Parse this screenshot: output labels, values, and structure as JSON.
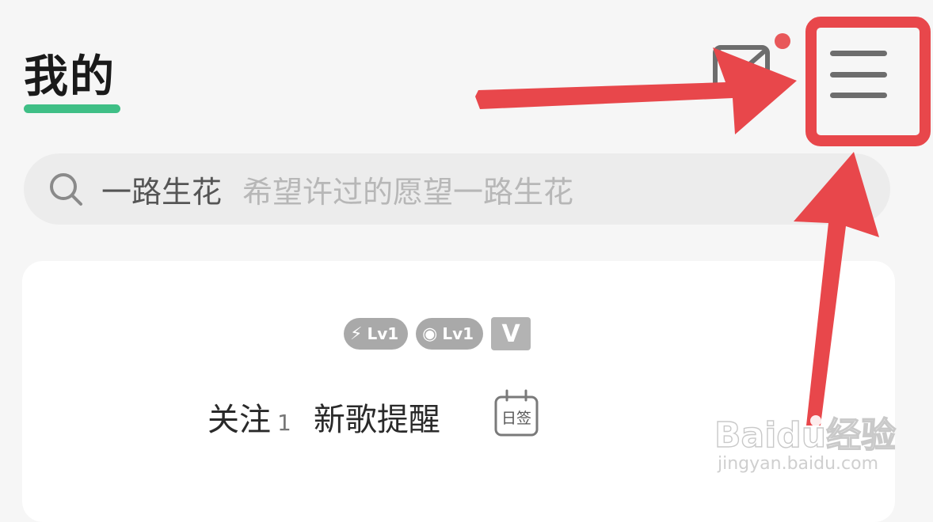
{
  "header": {
    "title": "我的",
    "accent_color": "#3fbf86",
    "message_icon": "message-icon",
    "notification_dot_color": "#e8585a",
    "menu_icon": "hamburger-menu-icon"
  },
  "search": {
    "icon": "search-icon",
    "keyword": "一路生花",
    "placeholder": "希望许过的愿望一路生花"
  },
  "profile": {
    "badges": [
      {
        "icon": "lightning-icon",
        "label": "Lv1"
      },
      {
        "icon": "disc-icon",
        "label": "Lv1"
      },
      {
        "icon": "vip-icon",
        "label": "V"
      }
    ],
    "follow_label": "关注",
    "follow_count": "1",
    "new_song_label": "新歌提醒",
    "checkin_label": "日签"
  },
  "watermark": {
    "logo_text": "Baidu经验",
    "url": "jingyan.baidu.com"
  },
  "annotation_color": "#e8474b"
}
